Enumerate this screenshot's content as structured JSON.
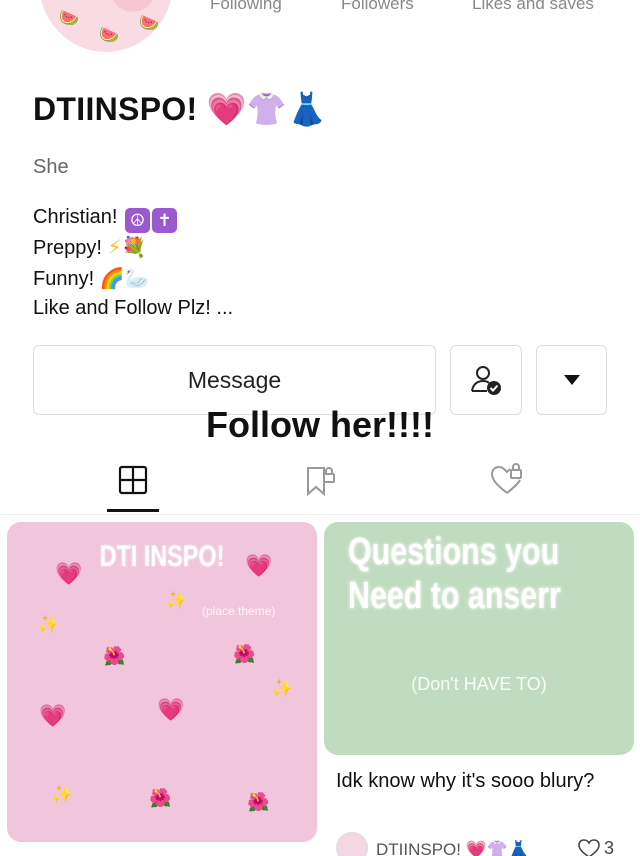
{
  "profile": {
    "name": "DTIINSPO!",
    "name_emojis": "💗👚👗",
    "pronoun": "She",
    "bio": [
      {
        "text": "Christian!",
        "emojis": "☮✝"
      },
      {
        "text": "Preppy!",
        "emojis": "⚡💐"
      },
      {
        "text": "Funny!",
        "emojis": "🌈🦢"
      },
      {
        "text": "Like and Follow Plz! ...",
        "emojis": ""
      }
    ]
  },
  "stats": {
    "following_label": "Following",
    "followers_label": "Followers",
    "likes_label": "Likes and saves"
  },
  "actions": {
    "message_label": "Message",
    "follow_icon": "person-check-icon",
    "dropdown_icon": "caret-down-icon"
  },
  "overlay_text": "Follow her!!!!",
  "tabs": [
    {
      "name": "grid-icon",
      "active": true
    },
    {
      "name": "locked-bookmark-icon",
      "active": false
    },
    {
      "name": "locked-heart-icon",
      "active": false
    }
  ],
  "posts": {
    "left": {
      "title": "DTI INSPO!",
      "subtitle": "(place theme)",
      "bg": "#f1c6dc"
    },
    "right": {
      "title_line1": "Questions you",
      "title_line2": "Need to anserr",
      "subtitle": "(Don't HAVE TO)",
      "bg": "#c0dcc0",
      "caption": "Idk know why it's sooo blury?",
      "author": "DTIINSPO! 💗👚👗",
      "likes": "3"
    }
  },
  "colors": {
    "accent": "#e0287a",
    "text": "#111111",
    "muted": "#888888"
  }
}
